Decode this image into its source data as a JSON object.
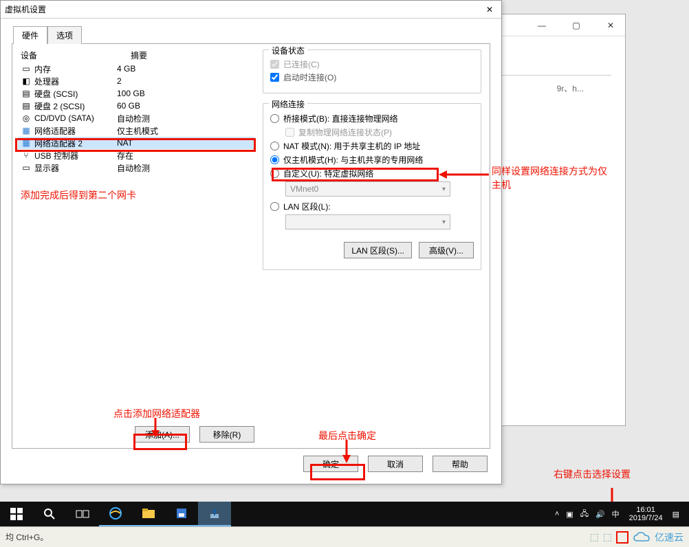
{
  "dialog": {
    "title": "虚拟机设置",
    "tabs": {
      "hardware": "硬件",
      "options": "选项"
    },
    "columns": {
      "device": "设备",
      "summary": "摘要"
    },
    "rows": [
      {
        "name": "内存",
        "summary": "4 GB",
        "icon": "memory"
      },
      {
        "name": "处理器",
        "summary": "2",
        "icon": "cpu"
      },
      {
        "name": "硬盘 (SCSI)",
        "summary": "100 GB",
        "icon": "disk"
      },
      {
        "name": "硬盘 2 (SCSI)",
        "summary": "60 GB",
        "icon": "disk"
      },
      {
        "name": "CD/DVD (SATA)",
        "summary": "自动检测",
        "icon": "cd"
      },
      {
        "name": "网络适配器",
        "summary": "仅主机模式",
        "icon": "net"
      },
      {
        "name": "网络适配器 2",
        "summary": "NAT",
        "icon": "net",
        "selected": true
      },
      {
        "name": "USB 控制器",
        "summary": "存在",
        "icon": "usb"
      },
      {
        "name": "显示器",
        "summary": "自动检测",
        "icon": "display"
      }
    ],
    "buttons": {
      "add": "添加(A)...",
      "remove": "移除(R)",
      "ok": "确定",
      "cancel": "取消",
      "help": "帮助"
    }
  },
  "device_status": {
    "legend": "设备状态",
    "connected": "已连接(C)",
    "connect_at_poweron": "启动时连接(O)"
  },
  "netconn": {
    "legend": "网络连接",
    "bridged": "桥接模式(B): 直接连接物理网络",
    "replicate": "复制物理网络连接状态(P)",
    "nat": "NAT 模式(N): 用于共享主机的 IP 地址",
    "hostonly": "仅主机模式(H): 与主机共享的专用网络",
    "custom": "自定义(U): 特定虚拟网络",
    "custom_value": "VMnet0",
    "lan": "LAN 区段(L):",
    "lan_value": "",
    "btn_lan": "LAN 区段(S)...",
    "btn_adv": "高级(V)..."
  },
  "annotations": {
    "a1": "添加完成后得到第二个网卡",
    "a2": "点击添加网络适配器",
    "a3": "最后点击确定",
    "a4": "同样设置网络连接方式为仅主机",
    "a5": "右键点击选择设置"
  },
  "back_window": {
    "snippet": "9r、h..."
  },
  "taskbar": {
    "time": "16:01",
    "date": "2019/7/24"
  },
  "statusbar": {
    "left": "均 Ctrl+G。",
    "brand": "亿速云"
  }
}
